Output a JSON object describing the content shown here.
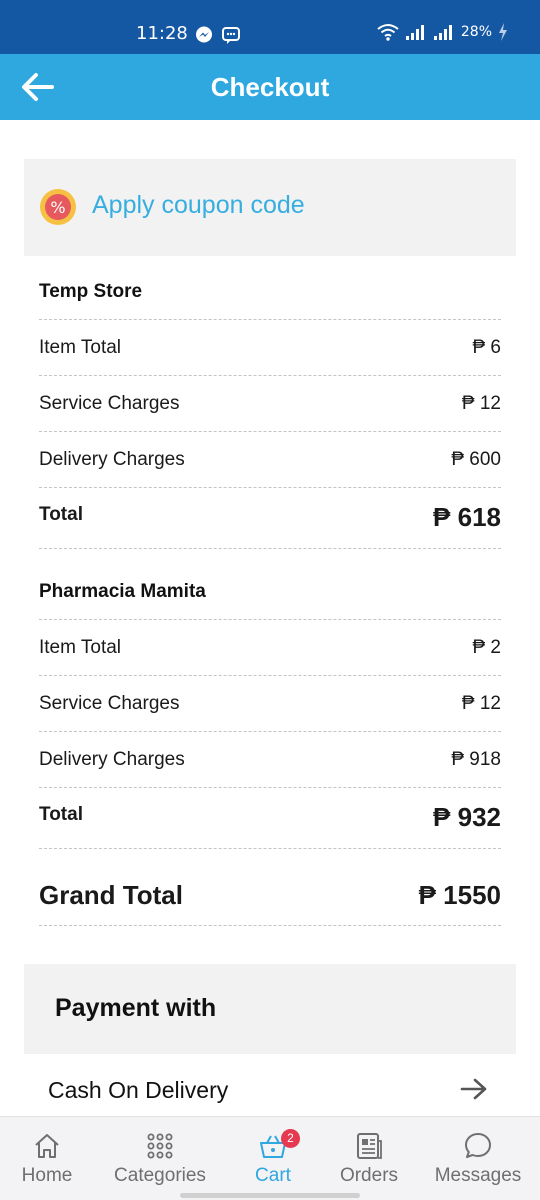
{
  "status_bar": {
    "time": "11:28",
    "battery": "28%"
  },
  "header": {
    "title": "Checkout"
  },
  "coupon": {
    "label": "Apply coupon code"
  },
  "stores": [
    {
      "name": "Temp Store",
      "rows": [
        {
          "label": "Item Total",
          "value": "₱ 6"
        },
        {
          "label": "Service Charges",
          "value": "₱ 12"
        },
        {
          "label": "Delivery Charges",
          "value": "₱ 600"
        }
      ],
      "total_label": "Total",
      "total_value": "₱ 618"
    },
    {
      "name": "Pharmacia Mamita",
      "rows": [
        {
          "label": "Item Total",
          "value": "₱ 2"
        },
        {
          "label": "Service Charges",
          "value": "₱ 12"
        },
        {
          "label": "Delivery Charges",
          "value": "₱ 918"
        }
      ],
      "total_label": "Total",
      "total_value": "₱ 932"
    }
  ],
  "grand_total": {
    "label": "Grand Total",
    "value": "₱ 1550"
  },
  "payment": {
    "title": "Payment with",
    "method": "Cash On Delivery"
  },
  "bottom_nav": {
    "items": [
      {
        "label": "Home",
        "icon": "home-icon"
      },
      {
        "label": "Categories",
        "icon": "grid-icon"
      },
      {
        "label": "Cart",
        "icon": "basket-icon",
        "badge": "2",
        "active": true
      },
      {
        "label": "Orders",
        "icon": "document-icon"
      },
      {
        "label": "Messages",
        "icon": "chat-icon"
      }
    ]
  },
  "colors": {
    "status_bar": "#1458a4",
    "app_bar": "#2fa7df",
    "accent": "#37aee0",
    "badge": "#e53950"
  }
}
